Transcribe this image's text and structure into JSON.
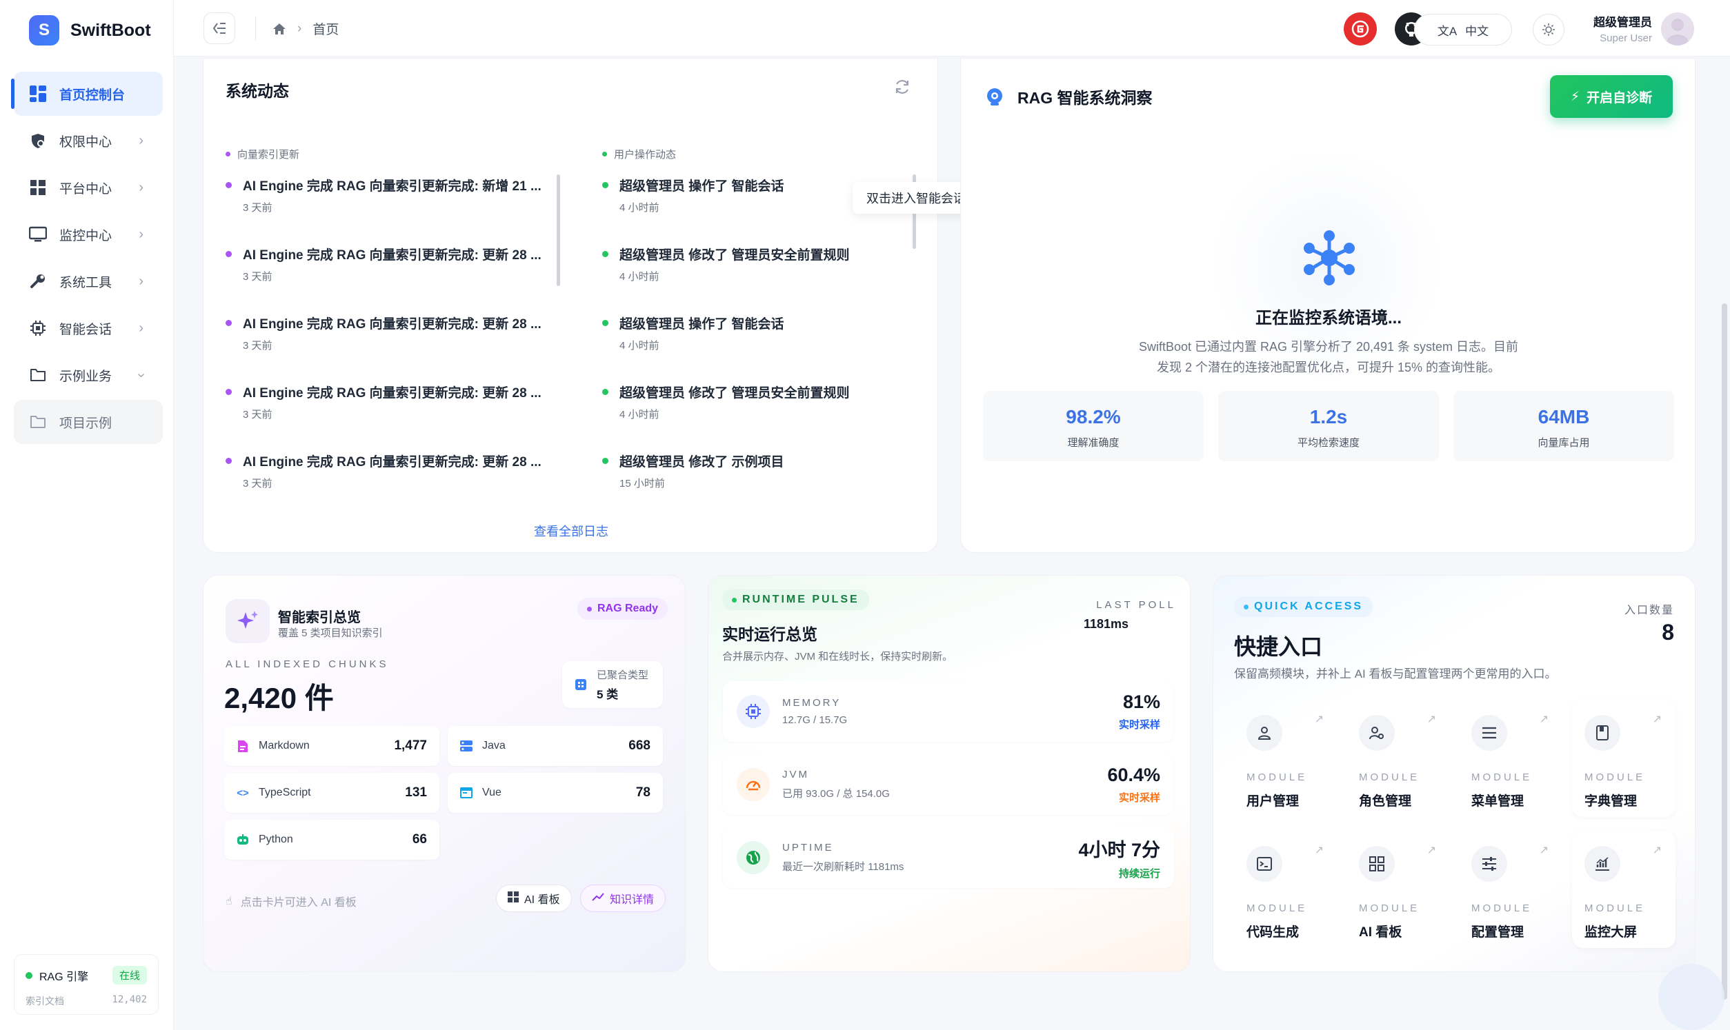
{
  "app": {
    "logo_letter": "S",
    "name": "SwiftBoot"
  },
  "sidebar": {
    "items": [
      {
        "label": "首页控制台",
        "icon": "dashboard-icon"
      },
      {
        "label": "权限中心",
        "icon": "shield-icon"
      },
      {
        "label": "平台中心",
        "icon": "grid-icon"
      },
      {
        "label": "监控中心",
        "icon": "monitor-icon"
      },
      {
        "label": "系统工具",
        "icon": "wrench-icon"
      },
      {
        "label": "智能会话",
        "icon": "chip-icon"
      },
      {
        "label": "示例业务",
        "icon": "folder-icon"
      },
      {
        "label": "项目示例",
        "icon": "folder-icon"
      }
    ],
    "rag": {
      "label": "RAG 引擎",
      "status": "在线",
      "doc_label": "索引文档",
      "doc_count": "12,402"
    }
  },
  "header": {
    "breadcrumb": "首页",
    "lang": "中文",
    "user_name": "超级管理员",
    "user_role": "Super User"
  },
  "activity": {
    "title": "系统动态",
    "left_head": "向量索引更新",
    "right_head": "用户操作动态",
    "left": [
      {
        "title": "AI Engine 完成 RAG 向量索引更新完成: 新增 21 ...",
        "time": "3 天前"
      },
      {
        "title": "AI Engine 完成 RAG 向量索引更新完成: 更新 28 ...",
        "time": "3 天前"
      },
      {
        "title": "AI Engine 完成 RAG 向量索引更新完成: 更新 28 ...",
        "time": "3 天前"
      },
      {
        "title": "AI Engine 完成 RAG 向量索引更新完成: 更新 28 ...",
        "time": "3 天前"
      },
      {
        "title": "AI Engine 完成 RAG 向量索引更新完成: 更新 28 ...",
        "time": "3 天前"
      }
    ],
    "right": [
      {
        "title": "超级管理员 操作了 智能会话",
        "time": "4 小时前"
      },
      {
        "title": "超级管理员 修改了 管理员安全前置规则",
        "time": "4 小时前"
      },
      {
        "title": "超级管理员 操作了 智能会话",
        "time": "4 小时前"
      },
      {
        "title": "超级管理员 修改了 管理员安全前置规则",
        "time": "4 小时前"
      },
      {
        "title": "超级管理员 修改了 示例项目",
        "time": "15 小时前"
      }
    ],
    "view_all": "查看全部日志",
    "tooltip": "双击进入智能会话"
  },
  "rag_insight": {
    "title": "RAG 智能系统洞察",
    "button": "开启自诊断",
    "status": "正在监控系统语境...",
    "desc_line1": "SwiftBoot 已通过内置 RAG 引擎分析了 20,491 条 system 日志。目前",
    "desc_line2": "发现 2 个潜在的连接池配置优化点，可提升 15% 的查询性能。",
    "stats": [
      {
        "value": "98.2%",
        "label": "理解准确度"
      },
      {
        "value": "1.2s",
        "label": "平均检索速度"
      },
      {
        "value": "64MB",
        "label": "向量库占用"
      }
    ]
  },
  "index_overview": {
    "title": "智能索引总览",
    "subtitle": "覆盖 5 类项目知识索引",
    "badge": "RAG Ready",
    "caption": "ALL INDEXED CHUNKS",
    "total": "2,420 件",
    "types_label": "已聚合类型",
    "types_value": "5 类",
    "languages": [
      {
        "name": "Markdown",
        "count": "1,477"
      },
      {
        "name": "Java",
        "count": "668"
      },
      {
        "name": "TypeScript",
        "count": "131"
      },
      {
        "name": "Vue",
        "count": "78"
      },
      {
        "name": "Python",
        "count": "66"
      }
    ],
    "hint": "点击卡片可进入 AI 看板",
    "btn_board": "AI 看板",
    "btn_detail": "知识详情"
  },
  "runtime": {
    "tag": "RUNTIME PULSE",
    "title": "实时运行总览",
    "desc": "合并展示内存、JVM 和在线时长，保持实时刷新。",
    "last_poll_label": "LAST POLL",
    "last_poll_value": "1181ms",
    "rows": [
      {
        "caption": "MEMORY",
        "sub": "12.7G / 15.7G",
        "value": "81%",
        "note": "实时采样"
      },
      {
        "caption": "JVM",
        "sub": "已用 93.0G / 总 154.0G",
        "value": "60.4%",
        "note": "实时采样"
      },
      {
        "caption": "UPTIME",
        "sub": "最近一次刷新耗时 1181ms",
        "value": "4小时 7分",
        "note": "持续运行"
      }
    ]
  },
  "quick": {
    "tag": "QUICK ACCESS",
    "title": "快捷入口",
    "desc": "保留高频模块，并补上 AI 看板与配置管理两个更常用的入口。",
    "count_label": "入口数量",
    "count": "8",
    "module_caption": "MODULE",
    "tiles": [
      {
        "label": "用户管理",
        "icon": "user-icon"
      },
      {
        "label": "角色管理",
        "icon": "user-gear-icon"
      },
      {
        "label": "菜单管理",
        "icon": "menu-icon"
      },
      {
        "label": "字典管理",
        "icon": "book-icon"
      },
      {
        "label": "代码生成",
        "icon": "terminal-icon"
      },
      {
        "label": "AI 看板",
        "icon": "dashboard-icon"
      },
      {
        "label": "配置管理",
        "icon": "sliders-icon"
      },
      {
        "label": "监控大屏",
        "icon": "chart-icon"
      }
    ]
  },
  "colors": {
    "accent": "#2563eb",
    "green": "#22c55e",
    "purple": "#a855f7",
    "orange": "#f97316"
  }
}
